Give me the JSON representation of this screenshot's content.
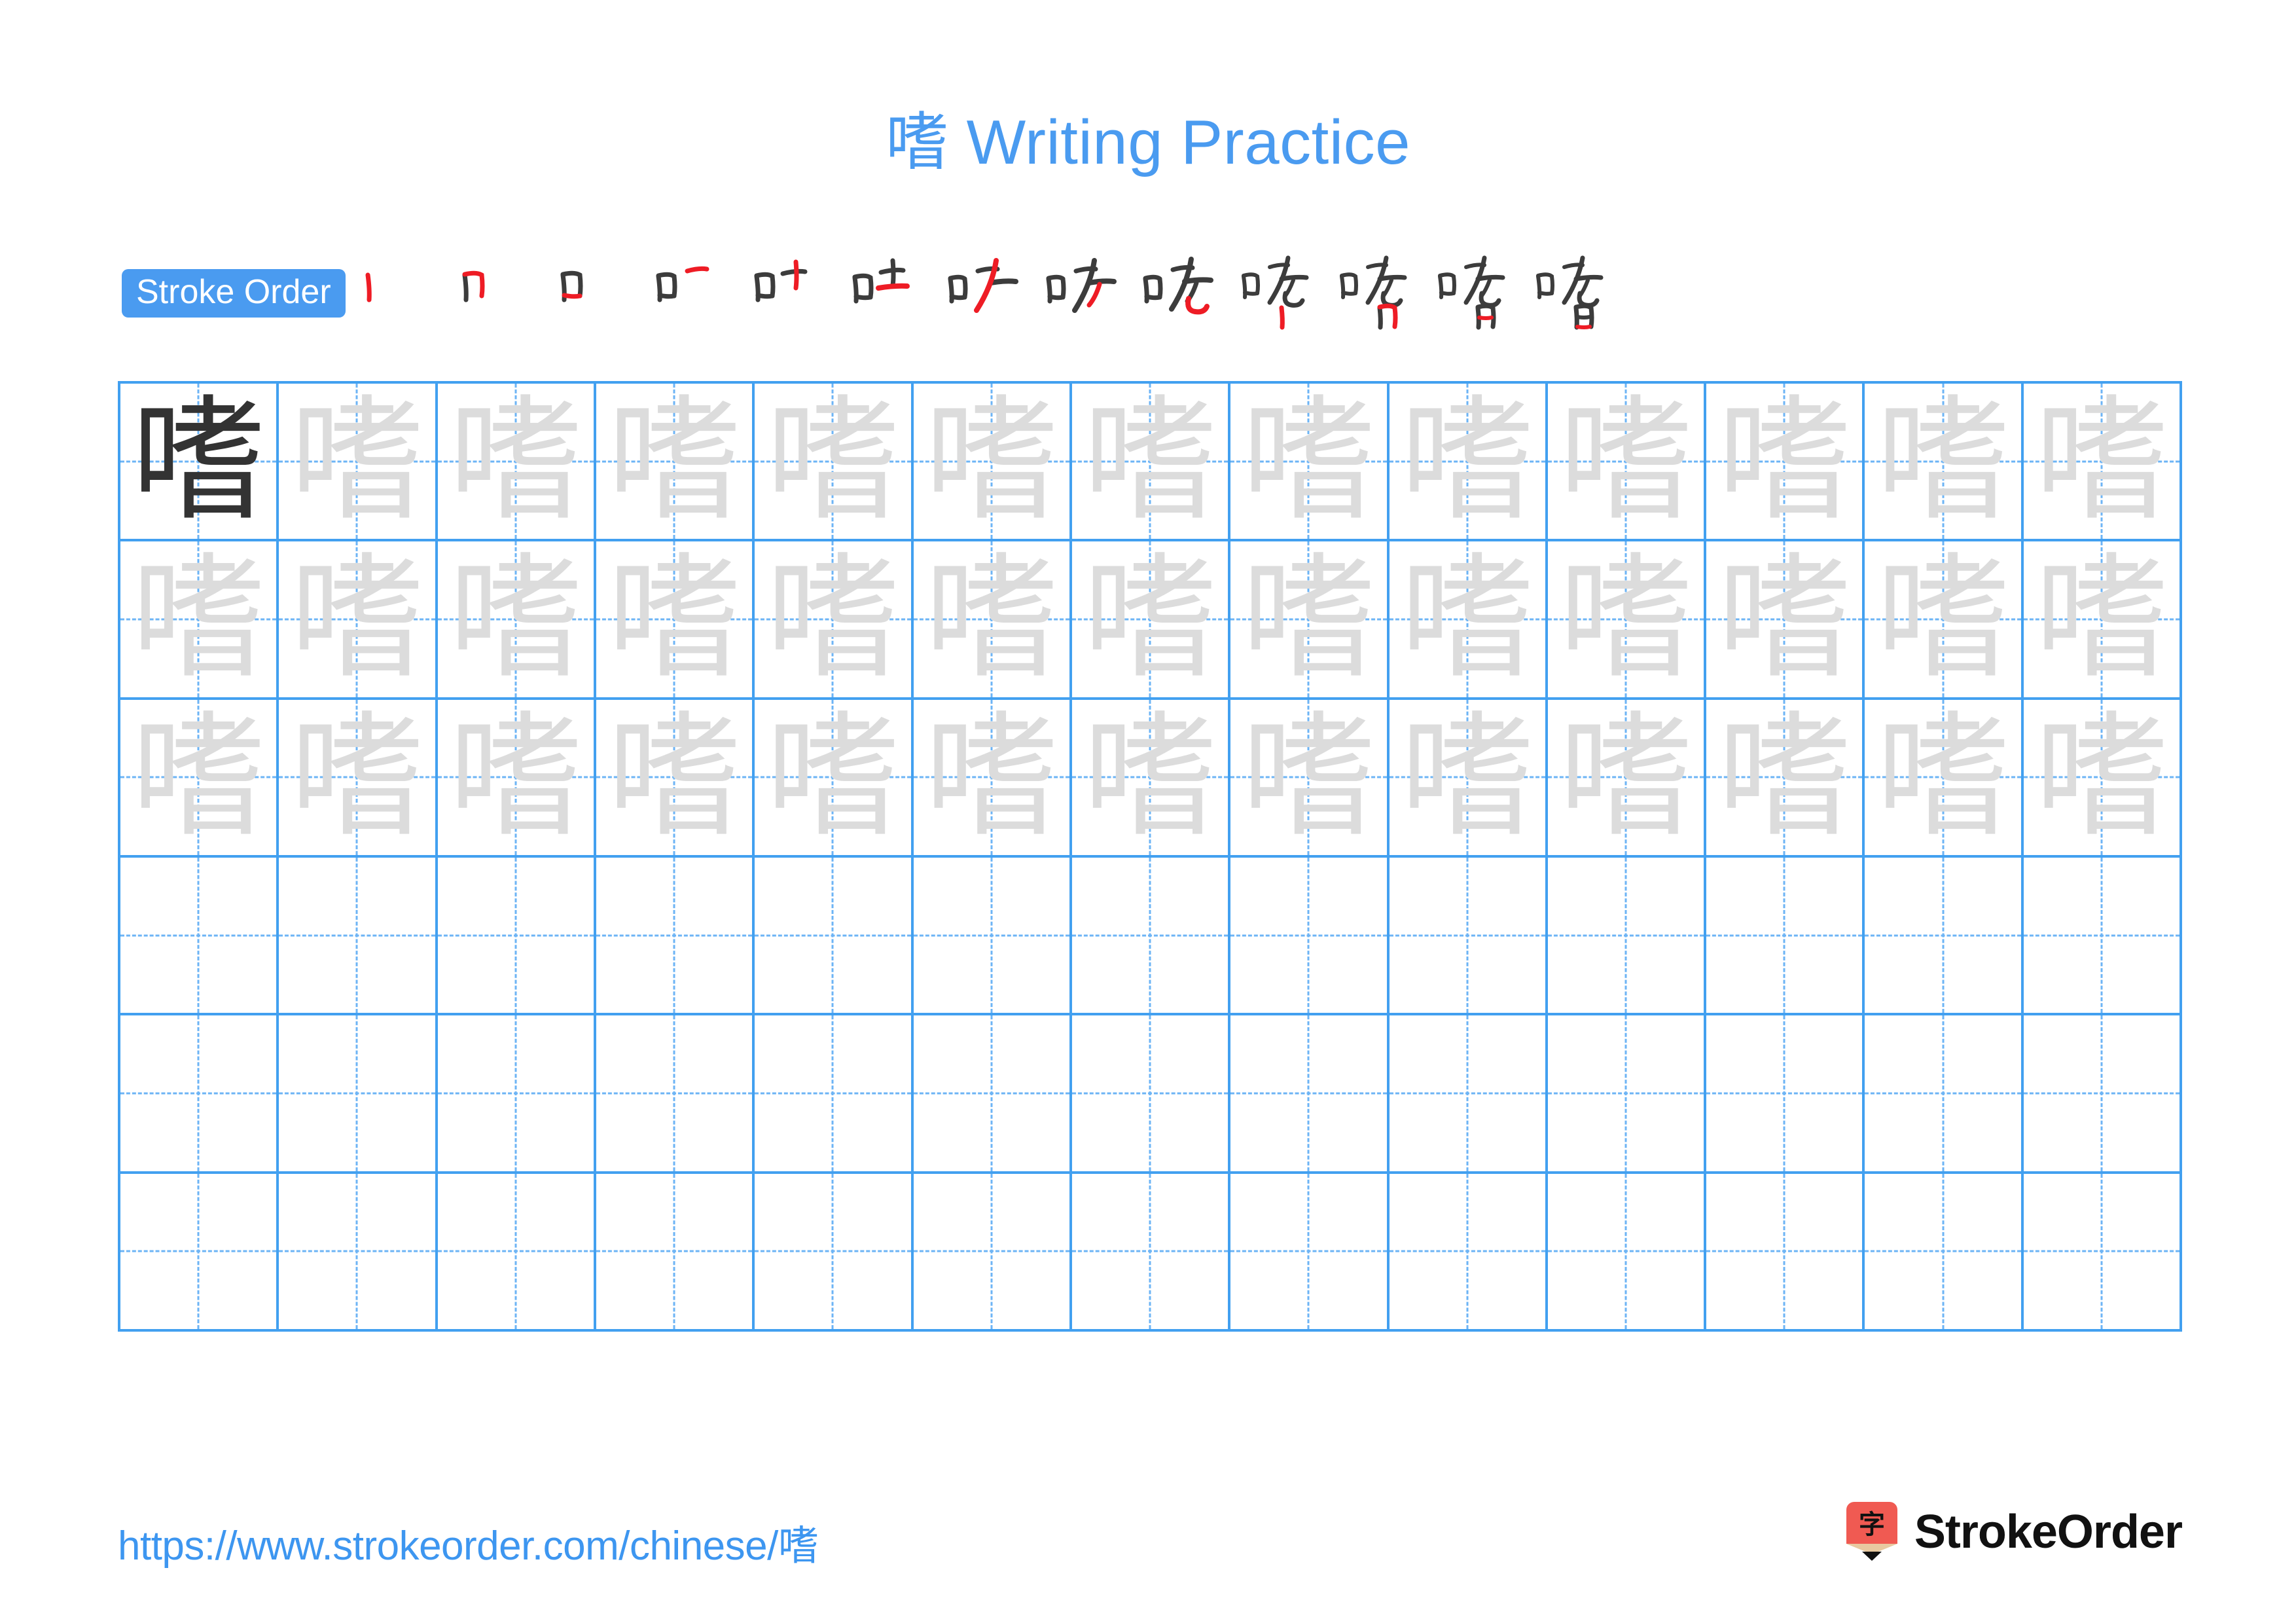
{
  "character": "嗜",
  "title": {
    "character": "嗜",
    "suffix": " Writing Practice",
    "full": "嗜 Writing Practice"
  },
  "colors": {
    "accent_blue": "#4a9bf0",
    "grid_blue": "#42a0f0",
    "guide_blue": "#6db4f5",
    "trace_gray": "#dcdcdc",
    "solid_char": "#333333",
    "stroke_new_red": "#ee1c25",
    "stroke_old_dark": "#3c3c3c",
    "logo_red": "#f05a52",
    "logo_wood": "#e8c9a0",
    "brand_text": "#111111"
  },
  "stroke_order": {
    "label": "Stroke Order",
    "stroke_count": 13,
    "steps": [
      {
        "index": 1,
        "partial": "丨",
        "new_stroke": "丨 vertical (left of 口)"
      },
      {
        "index": 2,
        "partial": "冂",
        "new_stroke": "𠃌 horizontal-turn"
      },
      {
        "index": 3,
        "partial": "口",
        "new_stroke": "一 bottom horizontal (closes 口)"
      },
      {
        "index": 4,
        "partial": "口一",
        "new_stroke": "一 horizontal (top of 耂)"
      },
      {
        "index": 5,
        "partial": "口十",
        "new_stroke": "丨 vertical"
      },
      {
        "index": 6,
        "partial": "吐",
        "new_stroke": "一 horizontal"
      },
      {
        "index": 7,
        "partial": "吖",
        "new_stroke": "丿 long left-falling"
      },
      {
        "index": 8,
        "partial": "吵",
        "new_stroke": "丿 short left-falling"
      },
      {
        "index": 9,
        "partial": "咾",
        "new_stroke": "乚 curved hook (匕)"
      },
      {
        "index": 10,
        "partial": "咾丨",
        "new_stroke": "丨 vertical (left of 日)"
      },
      {
        "index": 11,
        "partial": "嗜",
        "new_stroke": "𠃌 horizontal-turn (日)"
      },
      {
        "index": 12,
        "partial": "嗜",
        "new_stroke": "一 middle horizontal (日)"
      },
      {
        "index": 13,
        "partial": "嗜",
        "new_stroke": "一 bottom horizontal (closes 日)"
      }
    ]
  },
  "practice_grid": {
    "columns": 13,
    "rows": 6,
    "rows_data": [
      {
        "row": 1,
        "cells": [
          "solid",
          "trace",
          "trace",
          "trace",
          "trace",
          "trace",
          "trace",
          "trace",
          "trace",
          "trace",
          "trace",
          "trace",
          "trace"
        ]
      },
      {
        "row": 2,
        "cells": [
          "trace",
          "trace",
          "trace",
          "trace",
          "trace",
          "trace",
          "trace",
          "trace",
          "trace",
          "trace",
          "trace",
          "trace",
          "trace"
        ]
      },
      {
        "row": 3,
        "cells": [
          "trace",
          "trace",
          "trace",
          "trace",
          "trace",
          "trace",
          "trace",
          "trace",
          "trace",
          "trace",
          "trace",
          "trace",
          "trace"
        ]
      },
      {
        "row": 4,
        "cells": [
          "blank",
          "blank",
          "blank",
          "blank",
          "blank",
          "blank",
          "blank",
          "blank",
          "blank",
          "blank",
          "blank",
          "blank",
          "blank"
        ]
      },
      {
        "row": 5,
        "cells": [
          "blank",
          "blank",
          "blank",
          "blank",
          "blank",
          "blank",
          "blank",
          "blank",
          "blank",
          "blank",
          "blank",
          "blank",
          "blank"
        ]
      },
      {
        "row": 6,
        "cells": [
          "blank",
          "blank",
          "blank",
          "blank",
          "blank",
          "blank",
          "blank",
          "blank",
          "blank",
          "blank",
          "blank",
          "blank",
          "blank"
        ]
      }
    ]
  },
  "footer": {
    "url_prefix": "https://www.strokeorder.com/chinese/",
    "url_character": "嗜",
    "url_full": "https://www.strokeorder.com/chinese/嗜",
    "brand_name": "StrokeOrder",
    "logo_glyph": "字"
  }
}
